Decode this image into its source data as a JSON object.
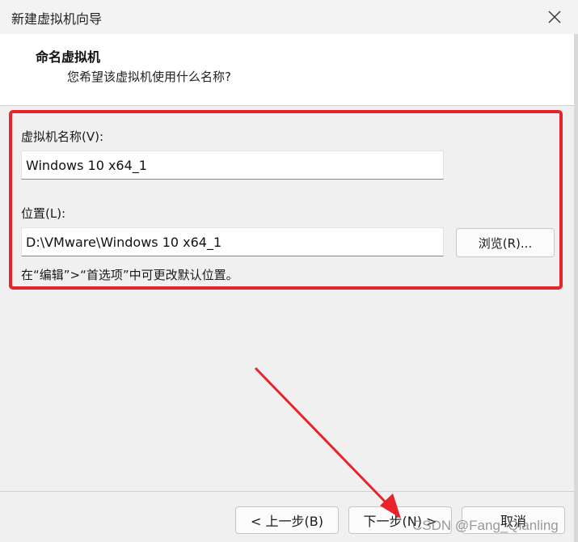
{
  "window": {
    "title": "新建虚拟机向导"
  },
  "header": {
    "title": "命名虚拟机",
    "subtitle": "您希望该虚拟机使用什么名称?"
  },
  "form": {
    "vm_name_label": "虚拟机名称(V):",
    "vm_name_value": "Windows 10 x64_1",
    "location_label": "位置(L):",
    "location_value": "D:\\VMware\\Windows 10 x64_1",
    "browse_label": "浏览(R)...",
    "hint": "在“编辑”>“首选项”中可更改默认位置。"
  },
  "footer": {
    "back_label": "< 上一步(B)",
    "next_label": "下一步(N) >",
    "cancel_label": "取消"
  },
  "watermark": "CSDN @Fang_Qianling",
  "colors": {
    "highlight": "#e8242a"
  }
}
